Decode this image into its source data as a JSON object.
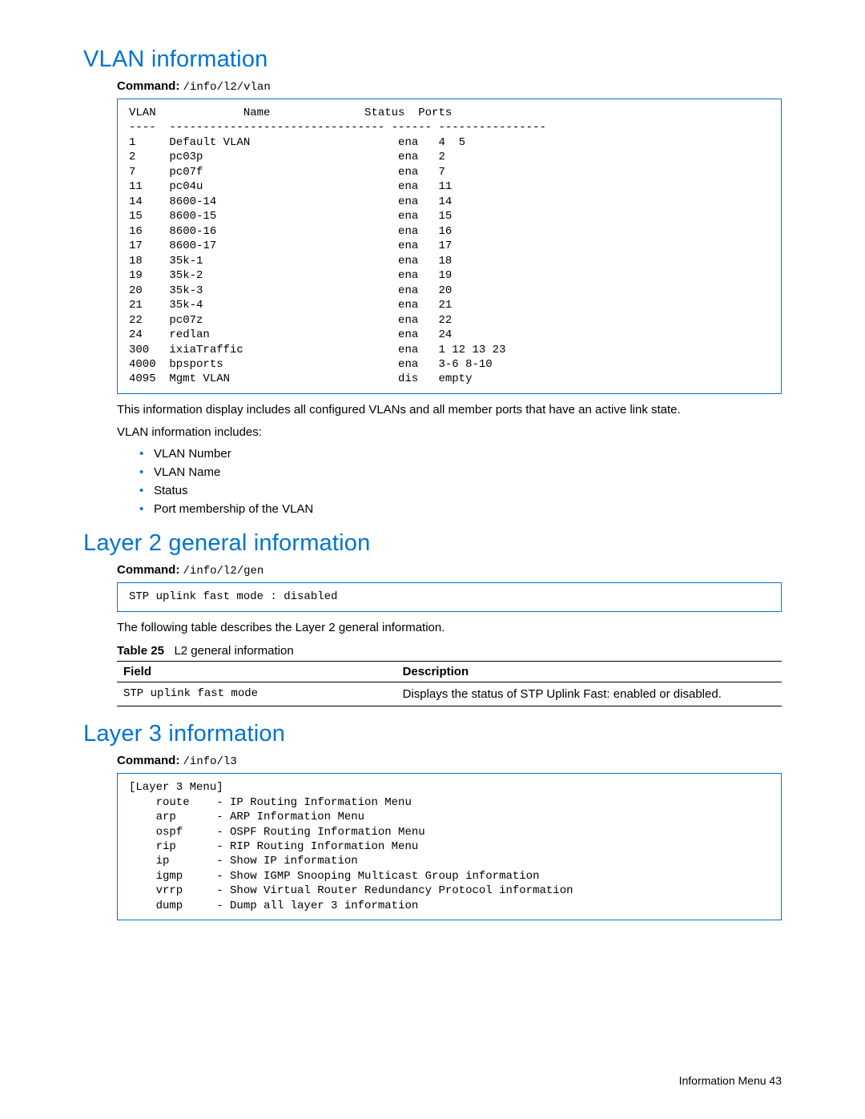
{
  "sections": {
    "vlan": {
      "heading": "VLAN information",
      "command_label": "Command:",
      "command_value": "/info/l2/vlan",
      "output_lines": [
        "VLAN             Name              Status  Ports",
        "----  -------------------------------- ------ ----------------",
        "1     Default VLAN                      ena   4  5",
        "2     pc03p                             ena   2",
        "7     pc07f                             ena   7",
        "11    pc04u                             ena   11",
        "14    8600-14                           ena   14",
        "15    8600-15                           ena   15",
        "16    8600-16                           ena   16",
        "17    8600-17                           ena   17",
        "18    35k-1                             ena   18",
        "19    35k-2                             ena   19",
        "20    35k-3                             ena   20",
        "21    35k-4                             ena   21",
        "22    pc07z                             ena   22",
        "24    redlan                            ena   24",
        "300   ixiaTraffic                       ena   1 12 13 23",
        "4000  bpsports                          ena   3-6 8-10",
        "4095  Mgmt VLAN                         dis   empty"
      ],
      "para1": "This information display includes all configured VLANs and all member ports that have an active link state.",
      "para2": "VLAN information includes:",
      "list": [
        "VLAN Number",
        "VLAN Name",
        "Status",
        "Port membership of the VLAN"
      ]
    },
    "l2gen": {
      "heading": "Layer 2 general information",
      "command_label": "Command:",
      "command_value": "/info/l2/gen",
      "output_lines": [
        "STP uplink fast mode : disabled"
      ],
      "para1": "The following table describes the Layer 2 general information.",
      "table_caption_label": "Table 25",
      "table_caption_text": "L2 general information",
      "table": {
        "header_field": "Field",
        "header_desc": "Description",
        "rows": [
          {
            "field": "STP uplink fast mode",
            "desc": "Displays the status of STP Uplink Fast: enabled or disabled."
          }
        ]
      }
    },
    "l3": {
      "heading": "Layer 3 information",
      "command_label": "Command:",
      "command_value": "/info/l3",
      "output_lines": [
        "[Layer 3 Menu]",
        "    route    - IP Routing Information Menu",
        "    arp      - ARP Information Menu",
        "    ospf     - OSPF Routing Information Menu",
        "    rip      - RIP Routing Information Menu",
        "    ip       - Show IP information",
        "    igmp     - Show IGMP Snooping Multicast Group information",
        "    vrrp     - Show Virtual Router Redundancy Protocol information",
        "    dump     - Dump all layer 3 information"
      ]
    }
  },
  "footer": {
    "text": "Information Menu   43"
  }
}
